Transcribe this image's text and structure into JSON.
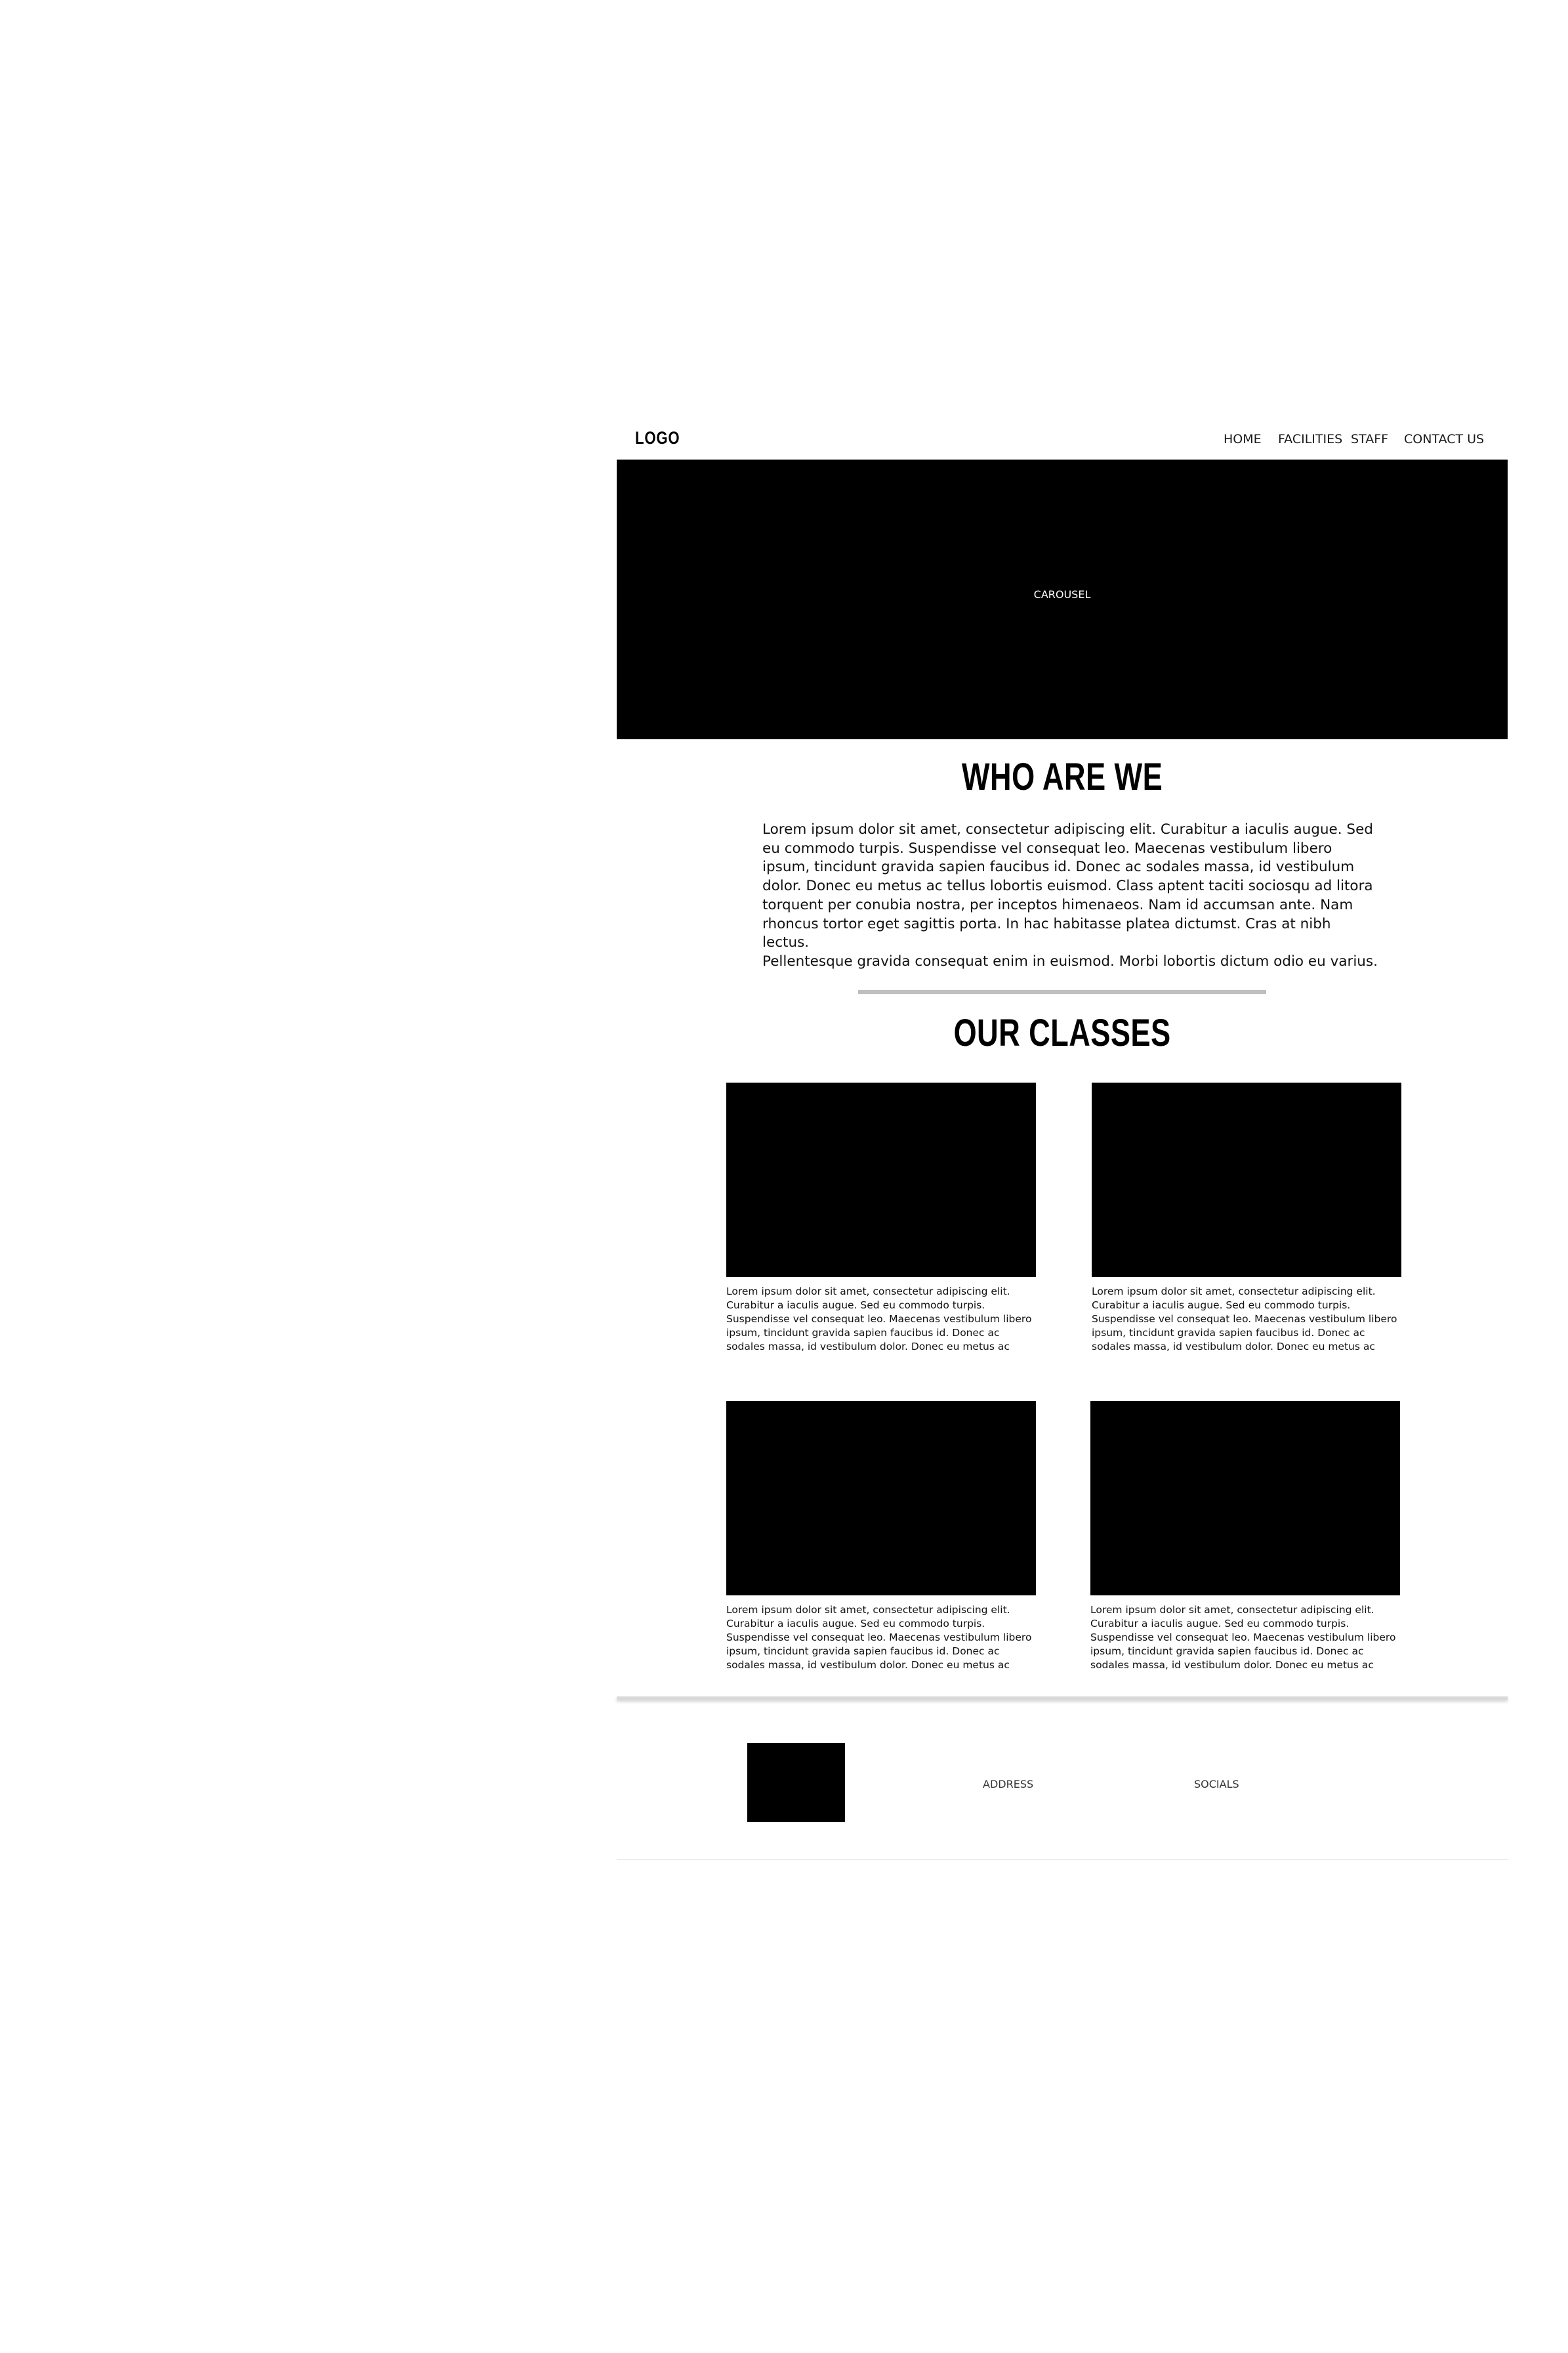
{
  "header": {
    "logo": "LOGO",
    "nav": [
      "HOME",
      "FACILITIES",
      "STAFF",
      "CONTACT US"
    ]
  },
  "carousel": {
    "label": "CAROUSEL"
  },
  "about": {
    "title": "WHO ARE WE",
    "lines": [
      "Lorem ipsum dolor sit amet, consectetur adipiscing elit. Curabitur a iaculis augue. Sed",
      "eu commodo turpis. Suspendisse vel consequat leo. Maecenas vestibulum libero",
      "ipsum, tincidunt gravida sapien faucibus id. Donec ac sodales massa, id vestibulum",
      "dolor. Donec eu metus ac tellus lobortis euismod. Class aptent taciti sociosqu ad litora",
      "torquent per conubia nostra, per inceptos himenaeos. Nam id accumsan ante. Nam",
      "rhoncus tortor eget sagittis porta. In hac habitasse platea dictumst. Cras at nibh lectus.",
      "Pellentesque gravida consequat enim in euismod. Morbi lobortis dictum odio eu varius."
    ]
  },
  "classes": {
    "title": "OUR CLASSES",
    "cards": [
      {
        "lines": [
          "Lorem ipsum dolor sit amet, consectetur adipiscing elit.",
          "Curabitur a iaculis augue. Sed eu commodo turpis.",
          "Suspendisse vel consequat leo. Maecenas vestibulum libero",
          "ipsum, tincidunt gravida sapien faucibus id. Donec ac",
          "sodales massa, id vestibulum dolor. Donec eu metus ac"
        ]
      },
      {
        "lines": [
          "Lorem ipsum dolor sit amet, consectetur adipiscing elit.",
          "Curabitur a iaculis augue. Sed eu commodo turpis.",
          "Suspendisse vel consequat leo. Maecenas vestibulum libero",
          "ipsum, tincidunt gravida sapien faucibus id. Donec ac",
          "sodales massa, id vestibulum dolor. Donec eu metus ac"
        ]
      },
      {
        "lines": [
          "Lorem ipsum dolor sit amet, consectetur adipiscing elit.",
          "Curabitur a iaculis augue. Sed eu commodo turpis.",
          "Suspendisse vel consequat leo. Maecenas vestibulum libero",
          "ipsum, tincidunt gravida sapien faucibus id. Donec ac",
          "sodales massa, id vestibulum dolor. Donec eu metus ac"
        ]
      },
      {
        "lines": [
          "Lorem ipsum dolor sit amet, consectetur adipiscing elit.",
          "Curabitur a iaculis augue. Sed eu commodo turpis.",
          "Suspendisse vel consequat leo. Maecenas vestibulum libero",
          "ipsum, tincidunt gravida sapien faucibus id. Donec ac",
          "sodales massa, id vestibulum dolor. Donec eu metus ac"
        ]
      }
    ]
  },
  "footer": {
    "address": "ADDRESS",
    "socials": "SOCIALS"
  }
}
